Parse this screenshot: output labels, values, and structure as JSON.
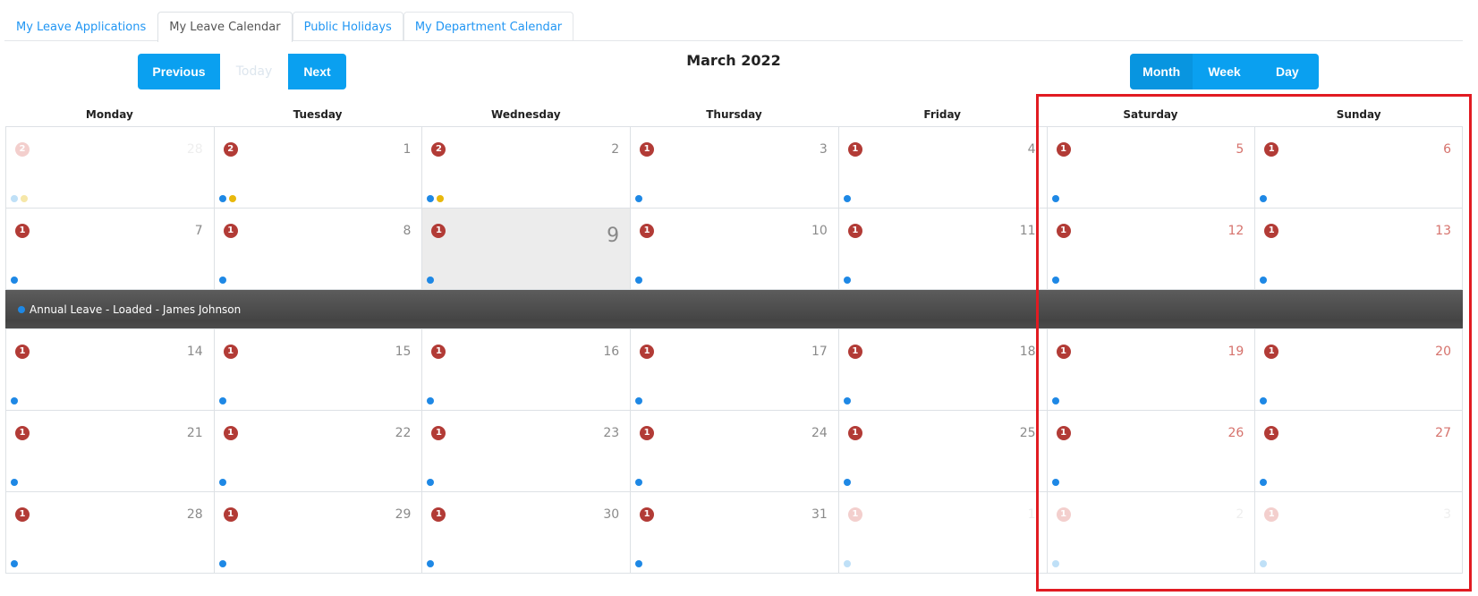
{
  "tabs": [
    {
      "label": "My Leave Applications"
    },
    {
      "label": "My Leave Calendar"
    },
    {
      "label": "Public Holidays"
    },
    {
      "label": "My Department Calendar"
    }
  ],
  "toolbar": {
    "previous_label": "Previous",
    "today_label": "Today",
    "next_label": "Next",
    "title": "March 2022",
    "views": [
      {
        "label": "Month"
      },
      {
        "label": "Week"
      },
      {
        "label": "Day"
      }
    ]
  },
  "calendar": {
    "days_of_week": [
      "Monday",
      "Tuesday",
      "Wednesday",
      "Thursday",
      "Friday",
      "Saturday",
      "Sunday"
    ],
    "weeks": [
      [
        {
          "day": "28",
          "count": "2",
          "other": true,
          "dots": [
            "blue",
            "yellow"
          ]
        },
        {
          "day": "1",
          "count": "2",
          "dots": [
            "blue",
            "yellow"
          ]
        },
        {
          "day": "2",
          "count": "2",
          "dots": [
            "blue",
            "yellow"
          ]
        },
        {
          "day": "3",
          "count": "1",
          "dots": [
            "blue"
          ]
        },
        {
          "day": "4",
          "count": "1",
          "dots": [
            "blue"
          ]
        },
        {
          "day": "5",
          "count": "1",
          "weekend": true,
          "dots": [
            "blue"
          ]
        },
        {
          "day": "6",
          "count": "1",
          "weekend": true,
          "dots": [
            "blue"
          ]
        }
      ],
      [
        {
          "day": "7",
          "count": "1",
          "dots": [
            "blue"
          ]
        },
        {
          "day": "8",
          "count": "1",
          "dots": [
            "blue"
          ]
        },
        {
          "day": "9",
          "count": "1",
          "today": true,
          "dots": [
            "blue"
          ]
        },
        {
          "day": "10",
          "count": "1",
          "dots": [
            "blue"
          ]
        },
        {
          "day": "11",
          "count": "1",
          "dots": [
            "blue"
          ]
        },
        {
          "day": "12",
          "count": "1",
          "weekend": true,
          "dots": [
            "blue"
          ]
        },
        {
          "day": "13",
          "count": "1",
          "weekend": true,
          "dots": [
            "blue"
          ]
        }
      ],
      [
        {
          "day": "14",
          "count": "1",
          "dots": [
            "blue"
          ]
        },
        {
          "day": "15",
          "count": "1",
          "dots": [
            "blue"
          ]
        },
        {
          "day": "16",
          "count": "1",
          "dots": [
            "blue"
          ]
        },
        {
          "day": "17",
          "count": "1",
          "dots": [
            "blue"
          ]
        },
        {
          "day": "18",
          "count": "1",
          "dots": [
            "blue"
          ]
        },
        {
          "day": "19",
          "count": "1",
          "weekend": true,
          "dots": [
            "blue"
          ]
        },
        {
          "day": "20",
          "count": "1",
          "weekend": true,
          "dots": [
            "blue"
          ]
        }
      ],
      [
        {
          "day": "21",
          "count": "1",
          "dots": [
            "blue"
          ]
        },
        {
          "day": "22",
          "count": "1",
          "dots": [
            "blue"
          ]
        },
        {
          "day": "23",
          "count": "1",
          "dots": [
            "blue"
          ]
        },
        {
          "day": "24",
          "count": "1",
          "dots": [
            "blue"
          ]
        },
        {
          "day": "25",
          "count": "1",
          "dots": [
            "blue"
          ]
        },
        {
          "day": "26",
          "count": "1",
          "weekend": true,
          "dots": [
            "blue"
          ]
        },
        {
          "day": "27",
          "count": "1",
          "weekend": true,
          "dots": [
            "blue"
          ]
        }
      ],
      [
        {
          "day": "28",
          "count": "1",
          "dots": [
            "blue"
          ]
        },
        {
          "day": "29",
          "count": "1",
          "dots": [
            "blue"
          ]
        },
        {
          "day": "30",
          "count": "1",
          "dots": [
            "blue"
          ]
        },
        {
          "day": "31",
          "count": "1",
          "dots": [
            "blue"
          ]
        },
        {
          "day": "1",
          "count": "1",
          "other": true,
          "dots": [
            "blue"
          ]
        },
        {
          "day": "2",
          "count": "1",
          "other": true,
          "dots": [
            "blue"
          ]
        },
        {
          "day": "3",
          "count": "1",
          "other": true,
          "dots": [
            "blue"
          ]
        }
      ]
    ],
    "expanded_event": {
      "label": "Annual Leave - Loaded - James Johnson",
      "after_week": 1
    }
  },
  "colors": {
    "accent": "#0aa0f0",
    "badge": "#b23b36",
    "event_dot_blue": "#1e88e5",
    "event_dot_yellow": "#e8b80c",
    "highlight_border": "#e11b22"
  }
}
